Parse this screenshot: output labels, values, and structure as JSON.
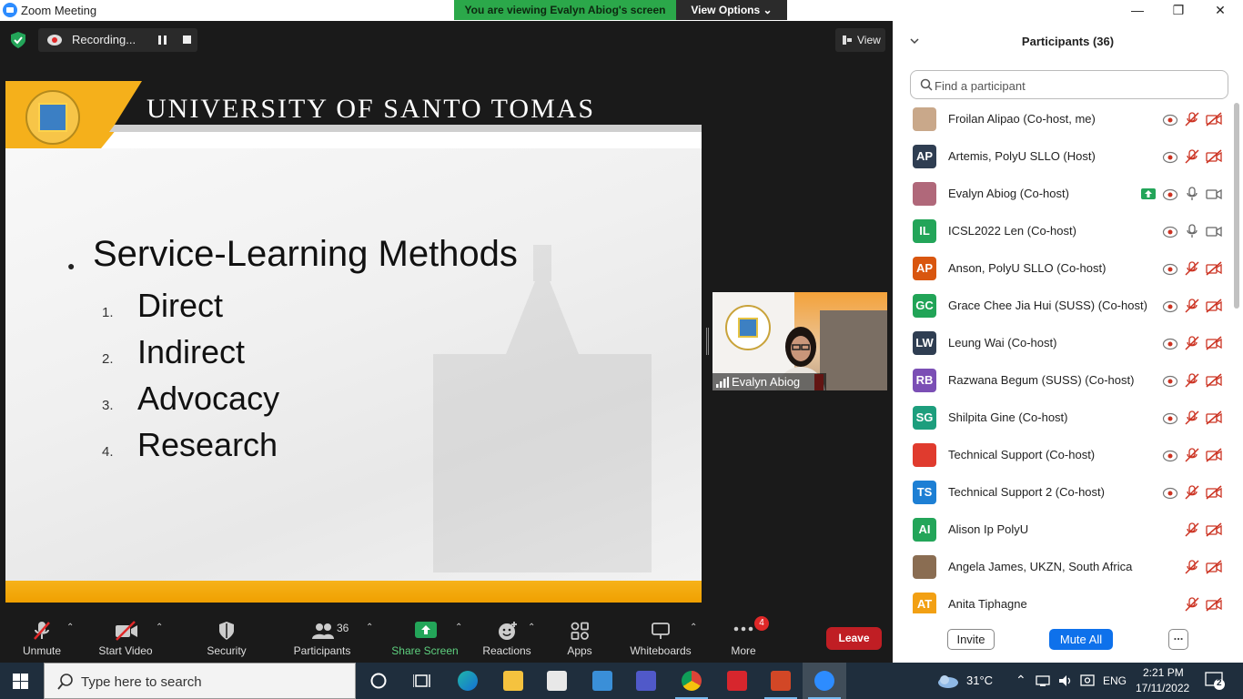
{
  "window": {
    "title": "Zoom Meeting"
  },
  "banner": {
    "viewing": "You are viewing Evalyn Abiog's screen",
    "view_options": "View Options"
  },
  "recording": {
    "label": "Recording..."
  },
  "view_button": {
    "label": "View"
  },
  "slide": {
    "header_title": "UNIVERSITY OF SANTO TOMAS",
    "heading": "Service-Learning Methods",
    "items": [
      {
        "num": "1.",
        "text": "Direct"
      },
      {
        "num": "2.",
        "text": "Indirect"
      },
      {
        "num": "3.",
        "text": "Advocacy"
      },
      {
        "num": "4.",
        "text": "Research"
      }
    ]
  },
  "video_tile": {
    "name": "Evalyn Abiog"
  },
  "toolbar": {
    "unmute": "Unmute",
    "start_video": "Start Video",
    "security": "Security",
    "participants": "Participants",
    "participants_count": "36",
    "share_screen": "Share Screen",
    "reactions": "Reactions",
    "apps": "Apps",
    "whiteboards": "Whiteboards",
    "more": "More",
    "more_badge": "4",
    "leave": "Leave"
  },
  "panel": {
    "title": "Participants (36)",
    "search_placeholder": "Find a participant",
    "participants": [
      {
        "initials": "",
        "name": "Froilan Alipao (Co-host, me)",
        "color": "#c9a88a"
      },
      {
        "initials": "AP",
        "name": "Artemis, PolyU SLLO (Host)",
        "color": "#2f3e52"
      },
      {
        "initials": "",
        "name": "Evalyn Abiog (Co-host)",
        "color": "#b0687a"
      },
      {
        "initials": "IL",
        "name": "ICSL2022 Len (Co-host)",
        "color": "#23a559"
      },
      {
        "initials": "AP",
        "name": "Anson, PolyU SLLO (Co-host)",
        "color": "#d9560f"
      },
      {
        "initials": "GC",
        "name": "Grace Chee Jia Hui (SUSS) (Co-host)",
        "color": "#21a457"
      },
      {
        "initials": "LW",
        "name": "Leung Wai (Co-host)",
        "color": "#2f3e52"
      },
      {
        "initials": "RB",
        "name": "Razwana Begum (SUSS) (Co-host)",
        "color": "#7b4fb5"
      },
      {
        "initials": "SG",
        "name": "Shilpita Gine (Co-host)",
        "color": "#1d9e7d"
      },
      {
        "initials": "",
        "name": "Technical Support (Co-host)",
        "color": "#e03b2e"
      },
      {
        "initials": "TS",
        "name": "Technical Support 2 (Co-host)",
        "color": "#1d7fd4"
      },
      {
        "initials": "AI",
        "name": "Alison Ip PolyU",
        "color": "#23a559"
      },
      {
        "initials": "",
        "name": "Angela James, UKZN, South Africa",
        "color": "#8a6d52"
      },
      {
        "initials": "AT",
        "name": "Anita Tiphagne",
        "color": "#f2a014"
      }
    ],
    "invite": "Invite",
    "mute_all": "Mute All",
    "more": "..."
  },
  "taskbar": {
    "search_placeholder": "Type here to search",
    "temperature": "31°C",
    "language": "ENG",
    "time": "2:21 PM",
    "date": "17/11/2022",
    "notifications": "2"
  }
}
